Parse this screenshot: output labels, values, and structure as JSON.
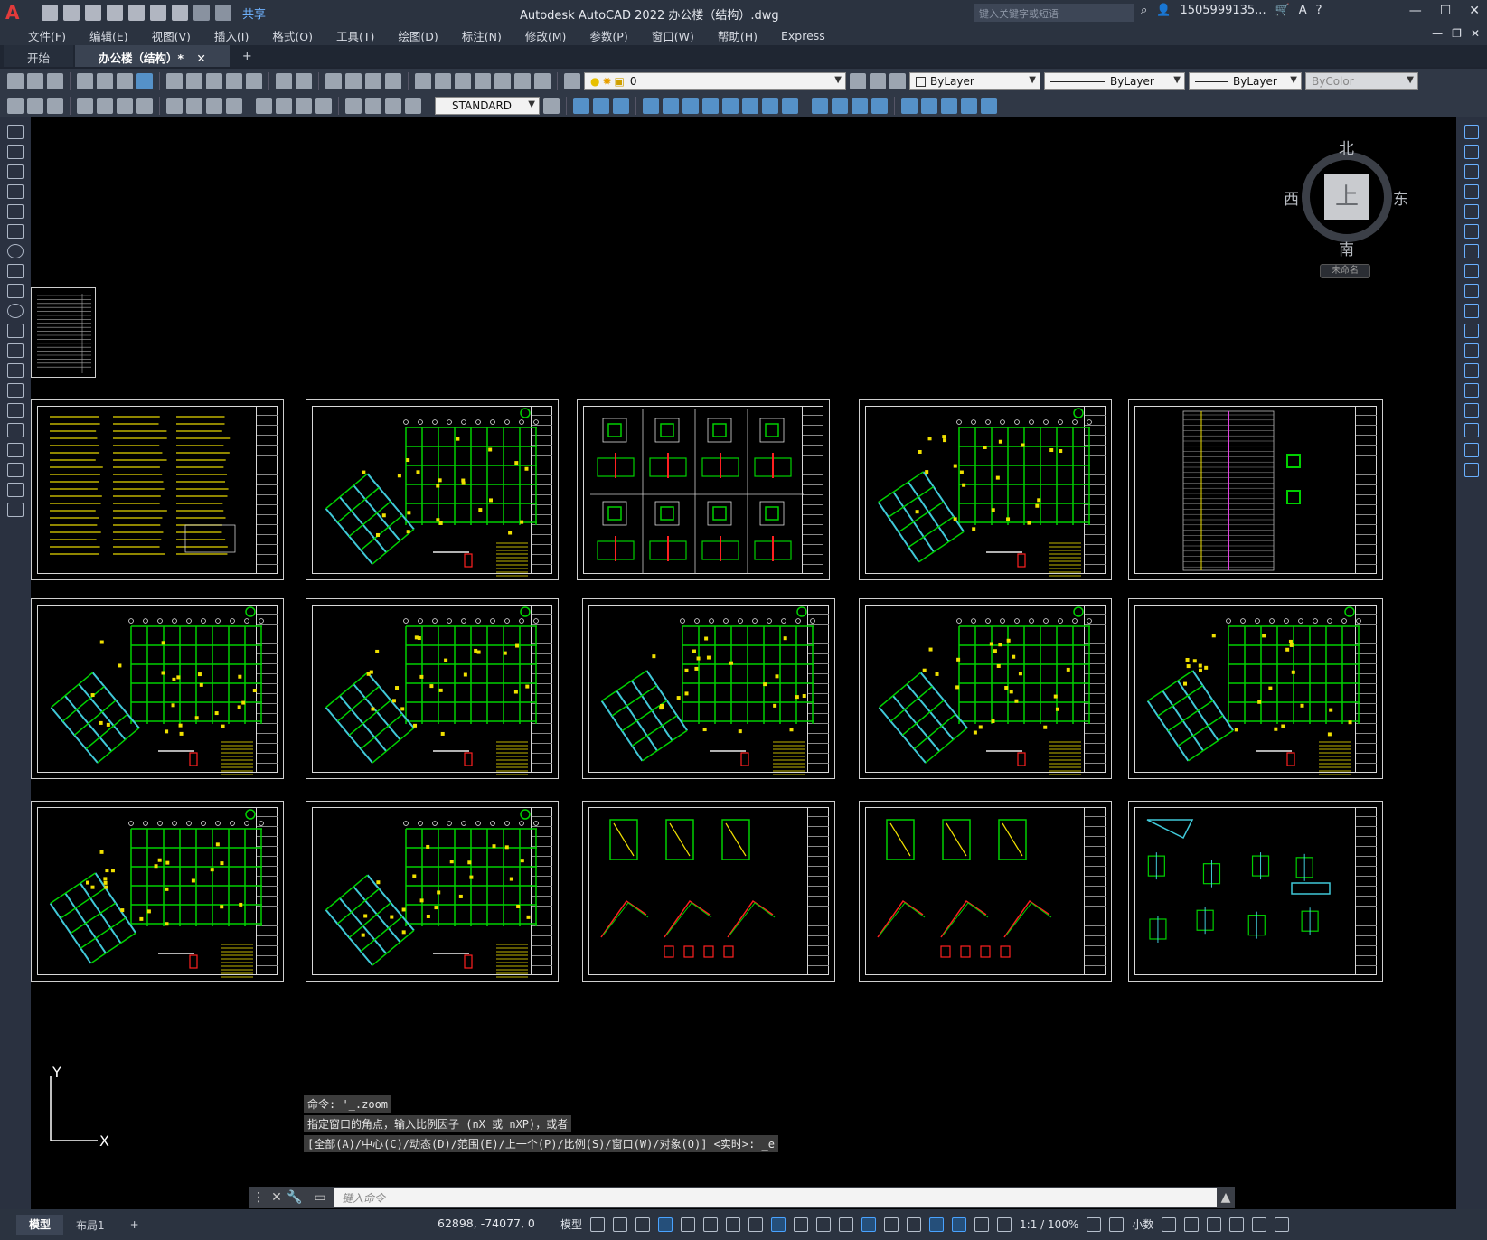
{
  "title_bar": {
    "app_icon": "A",
    "share_label": "共享",
    "title": "Autodesk AutoCAD 2022    办公楼（结构）.dwg",
    "search_placeholder": "键入关键字或短语",
    "user": "1505999135...",
    "help_icon": "help-icon"
  },
  "menu": {
    "items": [
      "文件(F)",
      "编辑(E)",
      "视图(V)",
      "插入(I)",
      "格式(O)",
      "工具(T)",
      "绘图(D)",
      "标注(N)",
      "修改(M)",
      "参数(P)",
      "窗口(W)",
      "帮助(H)",
      "Express"
    ]
  },
  "tabs": {
    "items": [
      {
        "label": "开始",
        "active": false
      },
      {
        "label": "办公楼（结构）*",
        "active": true
      }
    ],
    "add": "+",
    "close": "✕"
  },
  "toolbar1": {
    "layer_value": "0",
    "color_value": "ByLayer",
    "linetype_value": "ByLayer",
    "lineweight_value": "ByLayer",
    "plotstyle_value": "ByColor"
  },
  "toolbar2": {
    "textstyle_value": "STANDARD"
  },
  "viewcube": {
    "north": "北",
    "south": "南",
    "east": "东",
    "west": "西",
    "face": "上",
    "ucs_name": "未命名"
  },
  "ucs_icon": {
    "x_label": "X",
    "y_label": "Y"
  },
  "command": {
    "history": [
      "命令: '_.zoom",
      "指定窗口的角点，输入比例因子 (nX 或 nXP)，或者",
      "[全部(A)/中心(C)/动态(D)/范围(E)/上一个(P)/比例(S)/窗口(W)/对象(O)] <实时>: _e"
    ],
    "placeholder": "键入命令"
  },
  "status": {
    "layout_tabs": [
      {
        "label": "模型",
        "active": true
      },
      {
        "label": "布局1",
        "active": false
      }
    ],
    "add": "+",
    "coords": "62898, -74077, 0",
    "model_label": "模型",
    "scale": "1:1 / 100%",
    "units": "小数"
  },
  "colors": {
    "canvas": "#000000",
    "plan_green": "#00d000",
    "plan_cyan": "#40c8d8",
    "plan_yellow": "#f0e000",
    "plan_red": "#ff2020",
    "plan_magenta": "#e040e0"
  }
}
